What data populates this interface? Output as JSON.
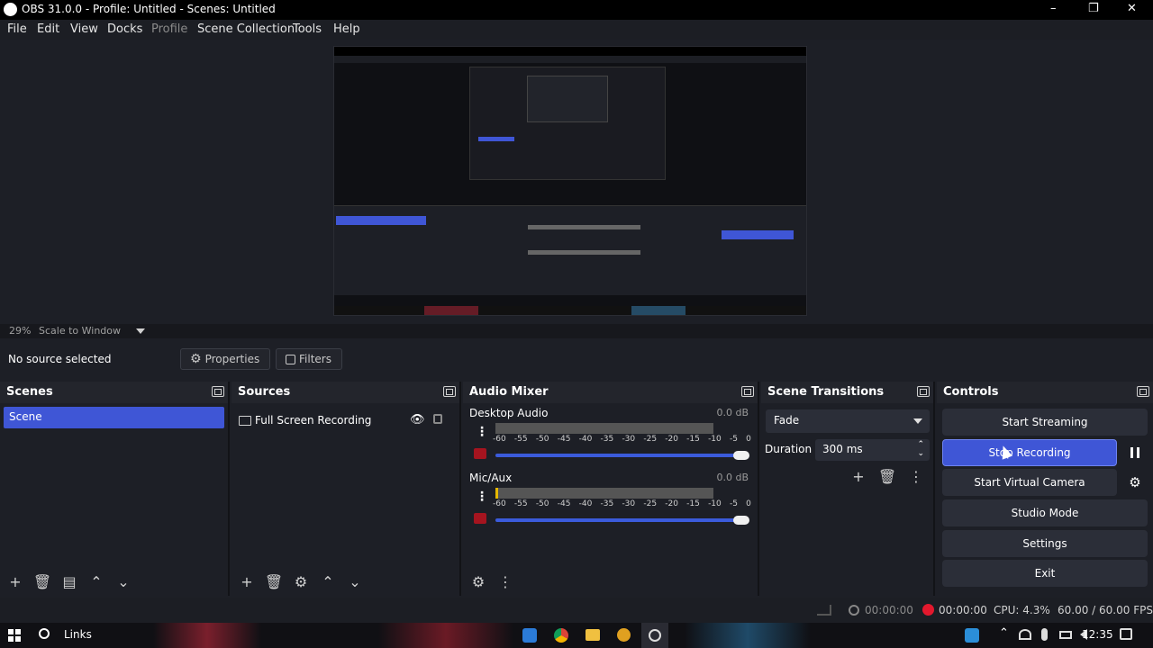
{
  "window": {
    "title": "OBS 31.0.0 - Profile: Untitled - Scenes: Untitled",
    "minimize": "–",
    "maximize": "❐",
    "close": "✕"
  },
  "menu": {
    "items": [
      "File",
      "Edit",
      "View",
      "Docks",
      "Profile",
      "Scene Collection",
      "Tools",
      "Help"
    ]
  },
  "zoom": {
    "percent": "29%",
    "mode": "Scale to Window"
  },
  "source_toolbar": {
    "no_source": "No source selected",
    "properties": "Properties",
    "filters": "Filters"
  },
  "scenes": {
    "title": "Scenes",
    "items": [
      "Scene"
    ]
  },
  "sources": {
    "title": "Sources",
    "items": [
      "Full Screen Recording"
    ]
  },
  "mixer": {
    "title": "Audio Mixer",
    "channels": [
      {
        "name": "Desktop Audio",
        "level": "0.0 dB"
      },
      {
        "name": "Mic/Aux",
        "level": "0.0 dB"
      }
    ],
    "ticks": [
      "-60",
      "-55",
      "-50",
      "-45",
      "-40",
      "-35",
      "-30",
      "-25",
      "-20",
      "-15",
      "-10",
      "-5",
      "0"
    ]
  },
  "transitions": {
    "title": "Scene Transitions",
    "selected": "Fade",
    "duration_label": "Duration",
    "duration_value": "300 ms"
  },
  "controls": {
    "title": "Controls",
    "start_streaming": "Start Streaming",
    "stop_recording": "Stop Recording",
    "start_virtual_camera": "Start Virtual Camera",
    "studio_mode": "Studio Mode",
    "settings": "Settings",
    "exit": "Exit"
  },
  "status": {
    "stream_time": "00:00:00",
    "rec_time": "00:00:00",
    "cpu": "CPU: 4.3%",
    "fps": "60.00 / 60.00 FPS"
  },
  "taskbar": {
    "search_label": "Links",
    "clock": "12:35"
  },
  "colors": {
    "accent": "#3f56d6",
    "record_red": "#e3182d",
    "background": "#1d1f26"
  }
}
